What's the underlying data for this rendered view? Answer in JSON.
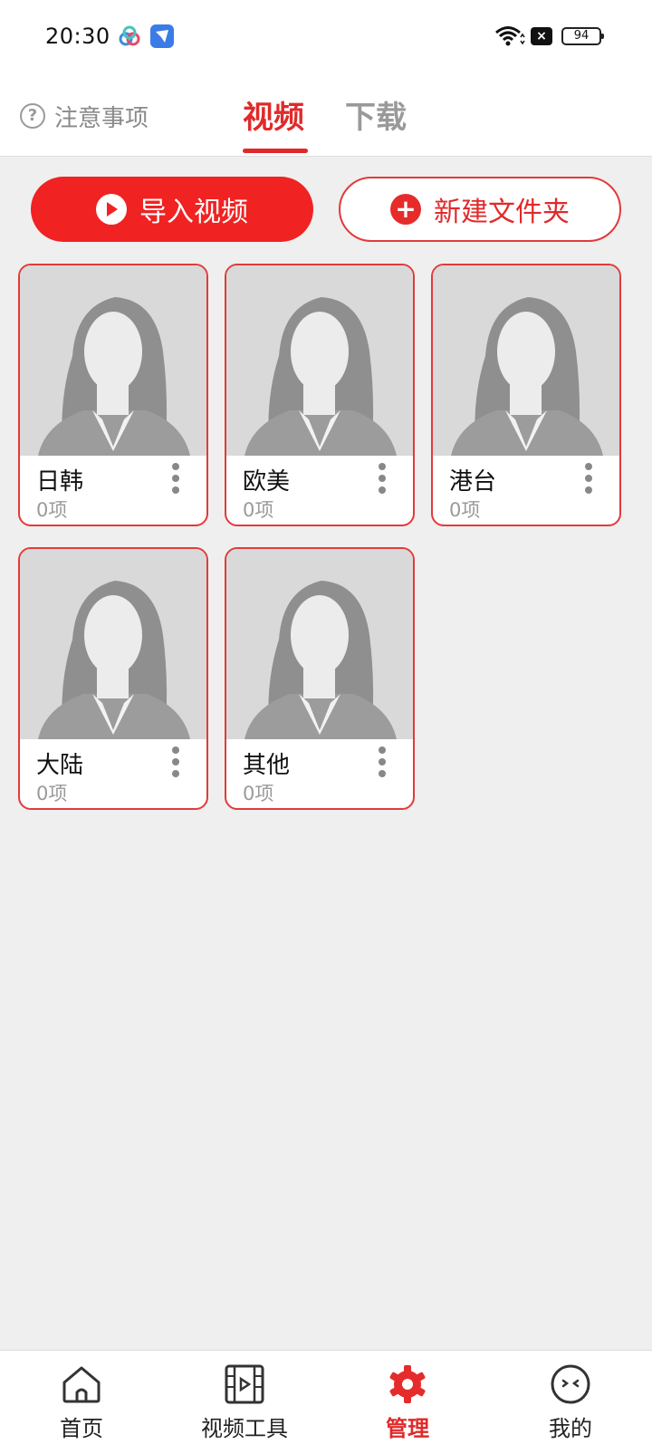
{
  "status_bar": {
    "time": "20:30",
    "battery": "94"
  },
  "header": {
    "notice_label": "注意事项",
    "tabs": [
      {
        "label": "视频",
        "active": true
      },
      {
        "label": "下载",
        "active": false
      }
    ]
  },
  "actions": {
    "import_label": "导入视频",
    "new_folder_label": "新建文件夹"
  },
  "folders": [
    {
      "name": "日韩",
      "count": "0项"
    },
    {
      "name": "欧美",
      "count": "0项"
    },
    {
      "name": "港台",
      "count": "0项"
    },
    {
      "name": "大陆",
      "count": "0项"
    },
    {
      "name": "其他",
      "count": "0项"
    }
  ],
  "bottom_nav": [
    {
      "label": "首页",
      "icon": "home-icon"
    },
    {
      "label": "视频工具",
      "icon": "film-icon"
    },
    {
      "label": "管理",
      "icon": "gear-icon",
      "active": true
    },
    {
      "label": "我的",
      "icon": "face-icon"
    }
  ],
  "colors": {
    "accent": "#e02a2a",
    "background": "#efefef"
  }
}
